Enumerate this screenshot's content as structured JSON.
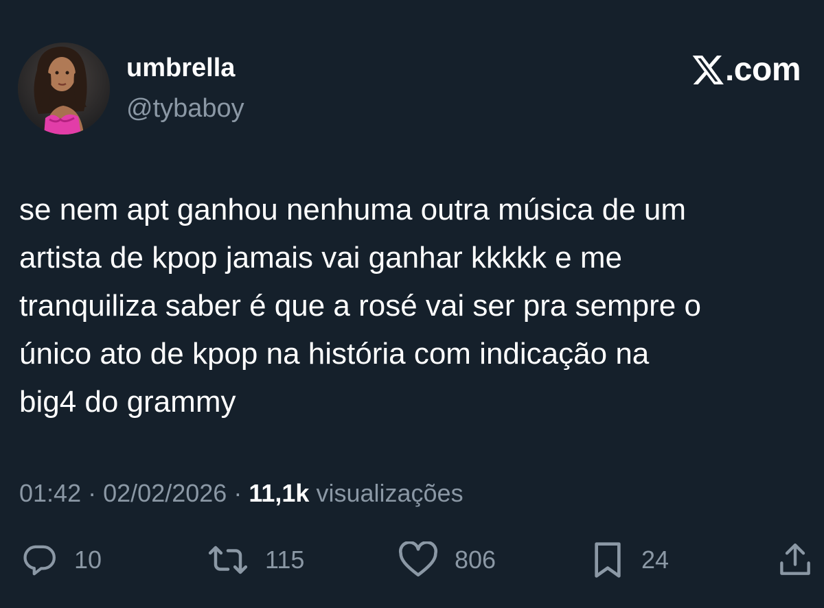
{
  "user": {
    "display_name": "umbrella",
    "handle": "@tybaboy",
    "avatar_icon": "profile-photo"
  },
  "site": {
    "logo_text": ".com",
    "logo_icon": "x-logo-icon"
  },
  "tweet": {
    "text": "se nem apt ganhou nenhuma outra música de um\nartista de kpop jamais vai ganhar kkkkk e me\ntranquiliza saber é que a rosé vai ser pra sempre o\núnico ato de kpop na história com indicação na\nbig4 do grammy"
  },
  "meta": {
    "time": "01:42",
    "date": "02/02/2026",
    "separator": "·",
    "views_count": "11,1k",
    "views_label": "visualizações"
  },
  "actions": {
    "reply": {
      "icon": "reply-icon",
      "count": "10"
    },
    "retweet": {
      "icon": "retweet-icon",
      "count": "115"
    },
    "like": {
      "icon": "heart-icon",
      "count": "806"
    },
    "bookmark": {
      "icon": "bookmark-icon",
      "count": "24"
    },
    "share": {
      "icon": "share-icon"
    }
  },
  "colors": {
    "background": "#15202b",
    "text_primary": "#ffffff",
    "text_secondary": "#8b98a5"
  }
}
